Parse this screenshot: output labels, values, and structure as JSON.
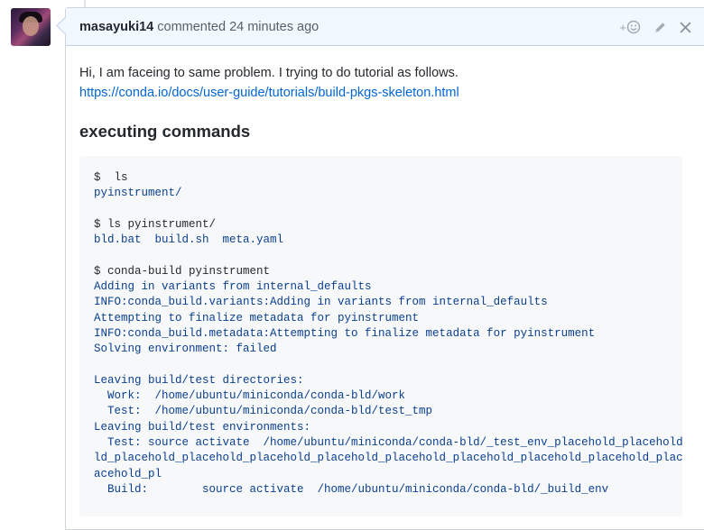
{
  "comment": {
    "author": "masayuki14",
    "action": "commented",
    "time": "24 minutes ago",
    "text": "Hi, I am faceing to same problem. I trying to do tutorial as follows.",
    "link": "https://conda.io/docs/user-guide/tutorials/build-pkgs-skeleton.html",
    "heading": "executing commands",
    "actions": {
      "reaction": "+",
      "reaction_icon": "smiley-icon",
      "edit_icon": "pencil-icon",
      "delete_icon": "close-icon"
    },
    "code_lines": [
      {
        "text": "$  ls",
        "kind": "cmd"
      },
      {
        "text": "pyinstrument/",
        "kind": "out"
      },
      {
        "text": "",
        "kind": "out"
      },
      {
        "text": "$ ls pyinstrument/",
        "kind": "cmd"
      },
      {
        "text": "bld.bat  build.sh  meta.yaml",
        "kind": "out"
      },
      {
        "text": "",
        "kind": "out"
      },
      {
        "text": "$ conda-build pyinstrument",
        "kind": "cmd"
      },
      {
        "text": "Adding in variants from internal_defaults",
        "kind": "out"
      },
      {
        "text": "INFO:conda_build.variants:Adding in variants from internal_defaults",
        "kind": "out"
      },
      {
        "text": "Attempting to finalize metadata for pyinstrument",
        "kind": "out"
      },
      {
        "text": "INFO:conda_build.metadata:Attempting to finalize metadata for pyinstrument",
        "kind": "out"
      },
      {
        "text": "Solving environment: failed",
        "kind": "out"
      },
      {
        "text": "",
        "kind": "out"
      },
      {
        "text": "Leaving build/test directories:",
        "kind": "out"
      },
      {
        "text": "  Work:  /home/ubuntu/miniconda/conda-bld/work",
        "kind": "out"
      },
      {
        "text": "  Test:  /home/ubuntu/miniconda/conda-bld/test_tmp",
        "kind": "out"
      },
      {
        "text": "Leaving build/test environments:",
        "kind": "out"
      },
      {
        "text": "  Test: source activate  /home/ubuntu/miniconda/conda-bld/_test_env_placehold_placehold_placehold_placehold",
        "kind": "out"
      },
      {
        "text": "ld_placehold_placehold_placehold_placehold_placehold_placehold_placehold_placehold_placehold_placehold",
        "kind": "out"
      },
      {
        "text": "acehold_pl",
        "kind": "out"
      },
      {
        "text": "  Build:        source activate  /home/ubuntu/miniconda/conda-bld/_build_env",
        "kind": "out"
      }
    ]
  }
}
